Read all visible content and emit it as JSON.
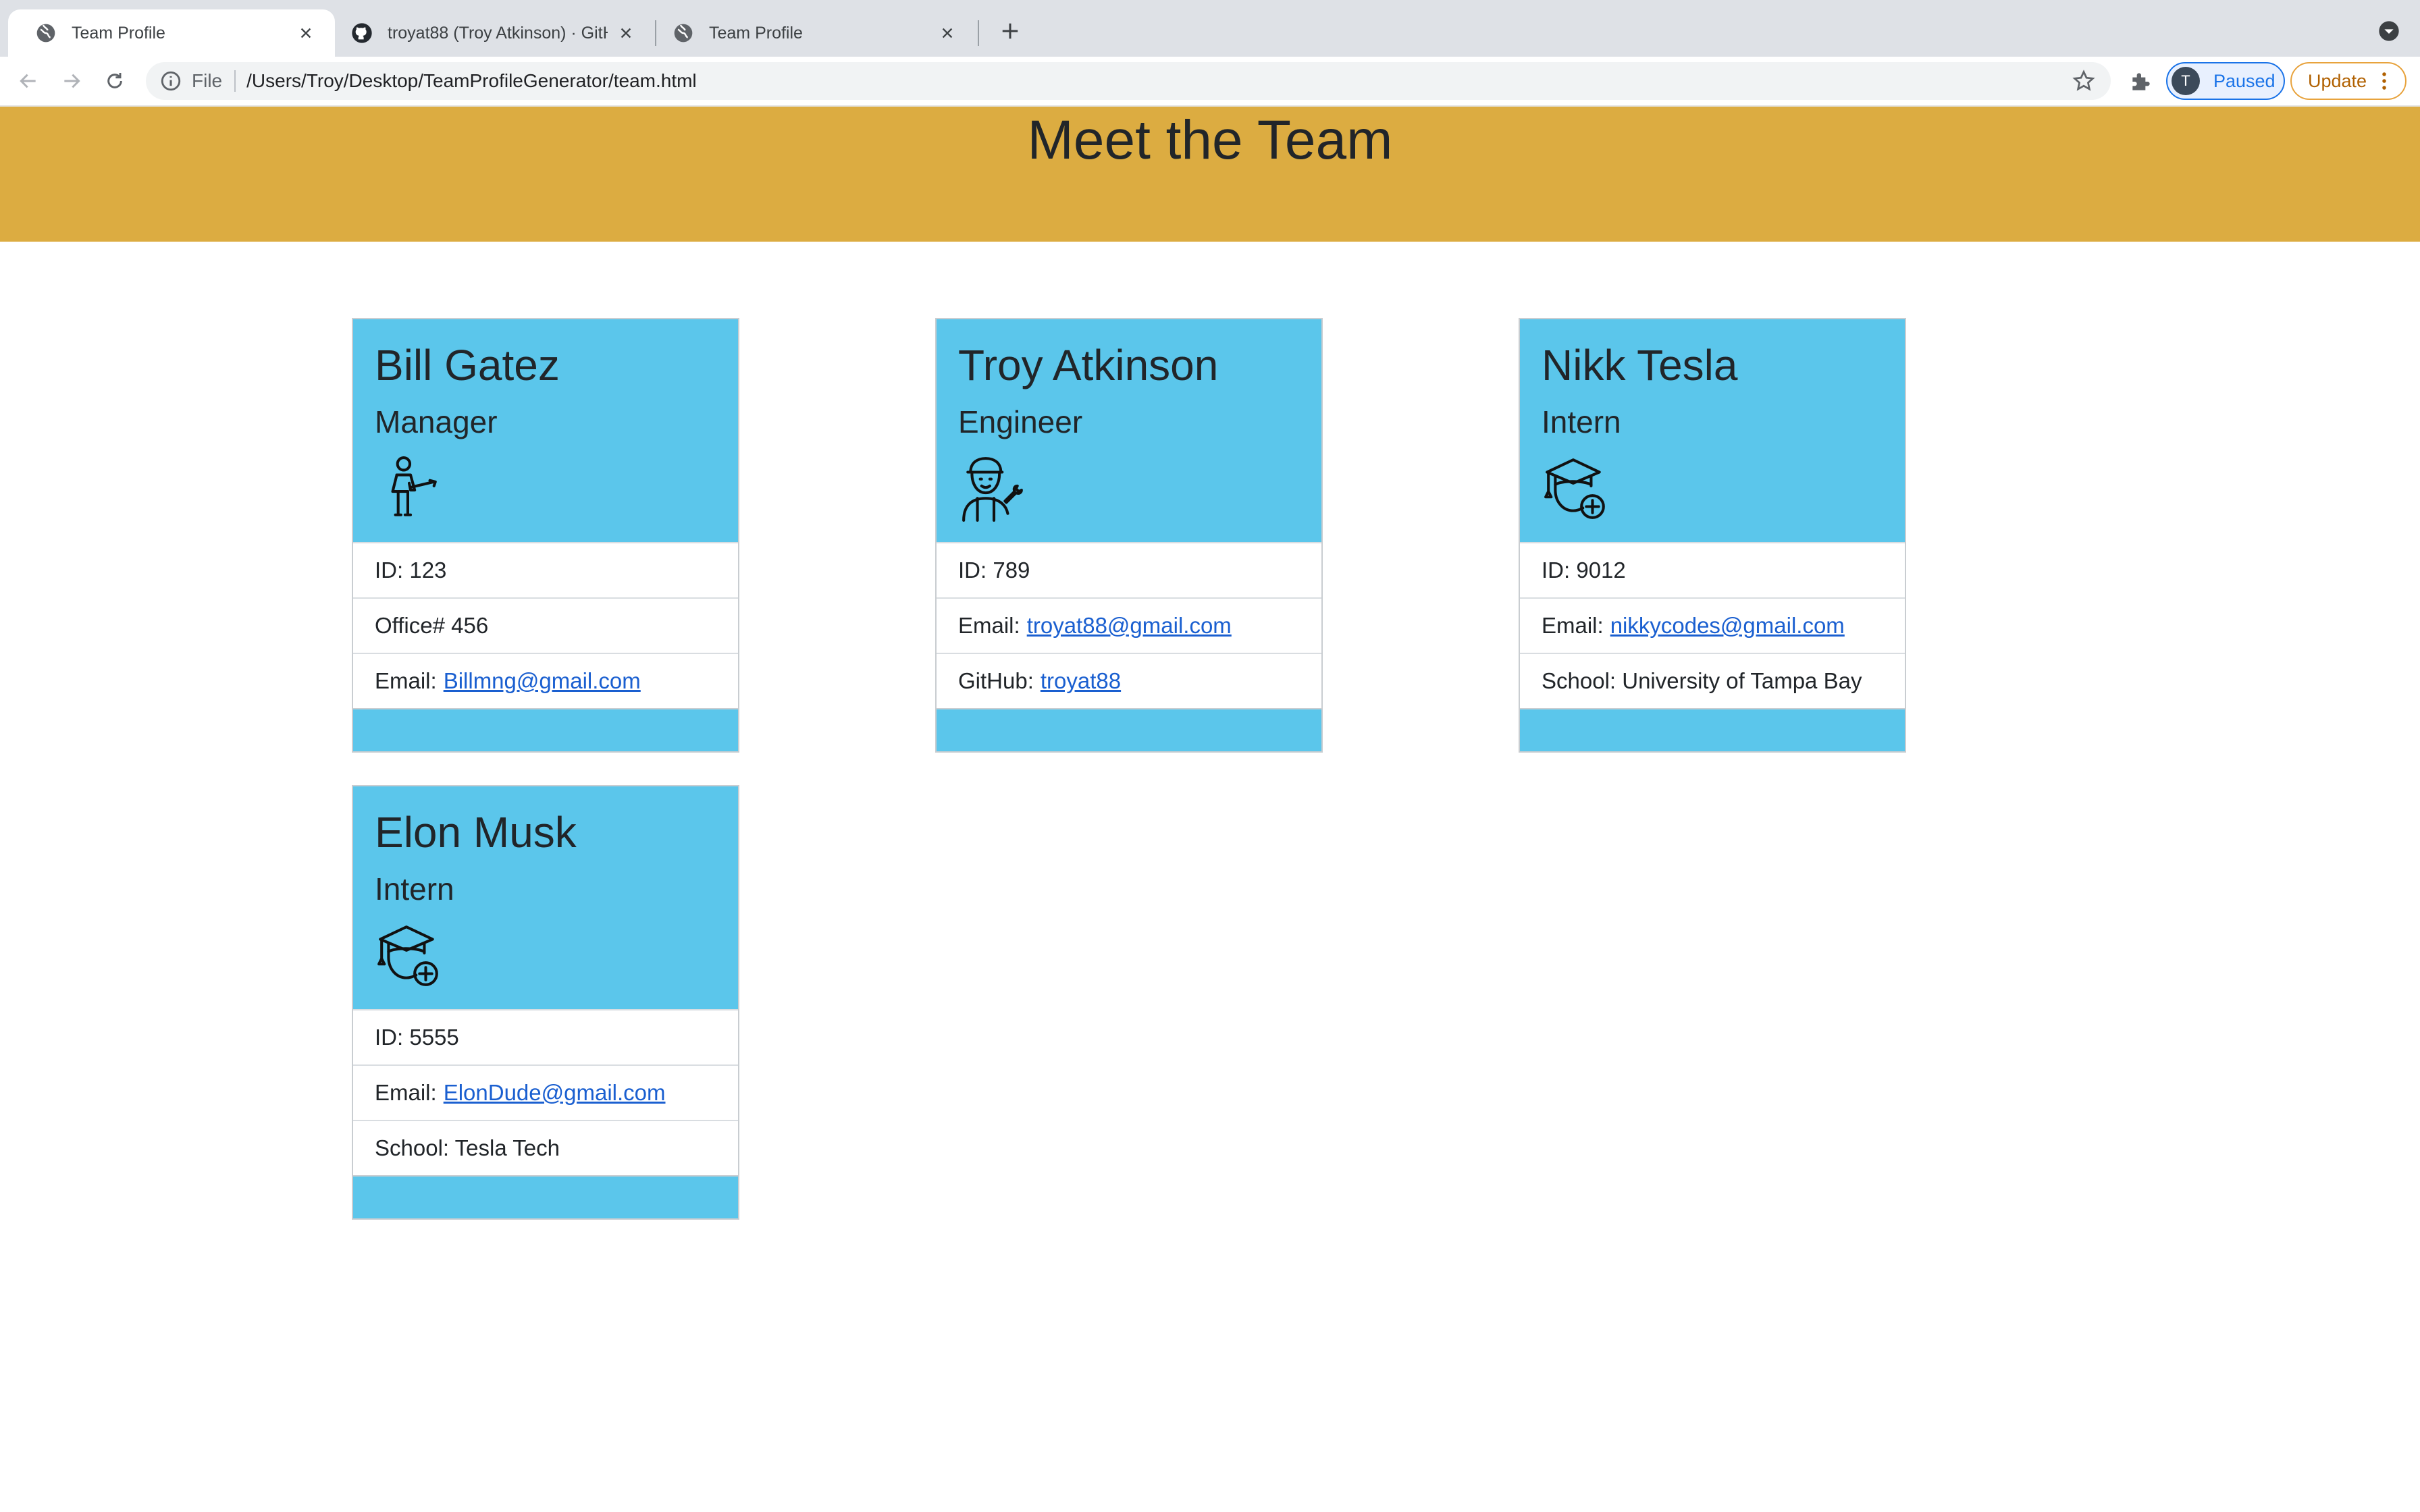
{
  "browser": {
    "tabs": [
      {
        "title": "Team Profile",
        "active": true,
        "favicon": "globe-icon"
      },
      {
        "title": "troyat88 (Troy Atkinson) · GitHub",
        "active": false,
        "favicon": "github-icon"
      },
      {
        "title": "Team Profile",
        "active": false,
        "favicon": "globe-icon"
      }
    ],
    "omnibox": {
      "scheme": "File",
      "url": "/Users/Troy/Desktop/TeamProfileGenerator/team.html"
    },
    "profile": {
      "initial": "T",
      "label": "Paused"
    },
    "update_label": "Update"
  },
  "page": {
    "title": "Meet the Team",
    "colors": {
      "header": "#dcac41",
      "card": "#5bc6eb",
      "link": "#1a5fd0"
    },
    "cards": [
      {
        "name": "Bill Gatez",
        "role": "Manager",
        "icon": "manager-icon",
        "rows": [
          {
            "label": "ID: 123"
          },
          {
            "label": "Office# 456"
          },
          {
            "label": "Email:",
            "link": "Billmng@gmail.com"
          }
        ]
      },
      {
        "name": "Troy Atkinson",
        "role": "Engineer",
        "icon": "engineer-icon",
        "rows": [
          {
            "label": "ID: 789"
          },
          {
            "label": "Email:",
            "link": "troyat88@gmail.com"
          },
          {
            "label": "GitHub:",
            "link": "troyat88"
          }
        ]
      },
      {
        "name": "Nikk Tesla",
        "role": "Intern",
        "icon": "graduate-icon",
        "rows": [
          {
            "label": "ID: 9012"
          },
          {
            "label": "Email:",
            "link": "nikkycodes@gmail.com"
          },
          {
            "label": "School: University of Tampa Bay"
          }
        ]
      },
      {
        "name": "Elon Musk",
        "role": "Intern",
        "icon": "graduate-icon",
        "rows": [
          {
            "label": "ID: 5555"
          },
          {
            "label": "Email:",
            "link": "ElonDude@gmail.com"
          },
          {
            "label": "School: Tesla Tech"
          }
        ]
      }
    ]
  }
}
